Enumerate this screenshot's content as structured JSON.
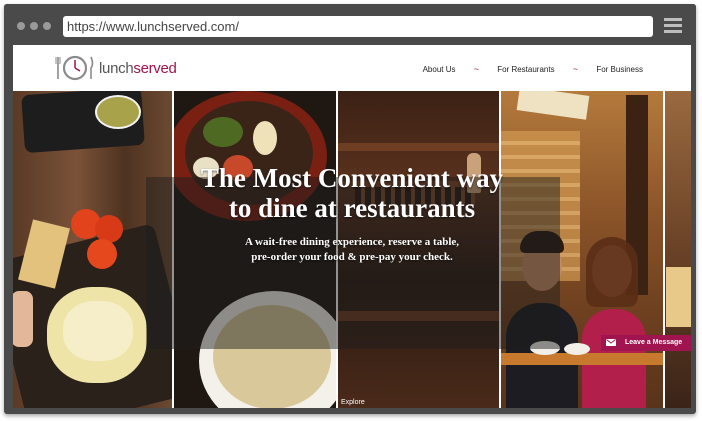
{
  "browser": {
    "url": "https://www.lunchserved.com/"
  },
  "site": {
    "logo": {
      "part1": "lunch",
      "part2": "served"
    },
    "nav": [
      {
        "label": "About Us"
      },
      {
        "label": "For Restaurants"
      },
      {
        "label": "For Business"
      }
    ],
    "nav_separator": "~"
  },
  "hero": {
    "headline_line1": "The Most Convenient way",
    "headline_line2": "to dine at restaurants",
    "sub_line1": "A wait-free dining experience, reserve a table,",
    "sub_line2": "pre-order your food & pre-pay your check.",
    "explore_label": "Explore"
  },
  "chat": {
    "label": "Leave a Message",
    "color": "#a0144f"
  },
  "colors": {
    "brand": "#a0144f",
    "chrome": "#4a4a4a"
  },
  "icons": [
    "clock-fork-knife-logo-icon",
    "menu-icon",
    "envelope-icon"
  ]
}
